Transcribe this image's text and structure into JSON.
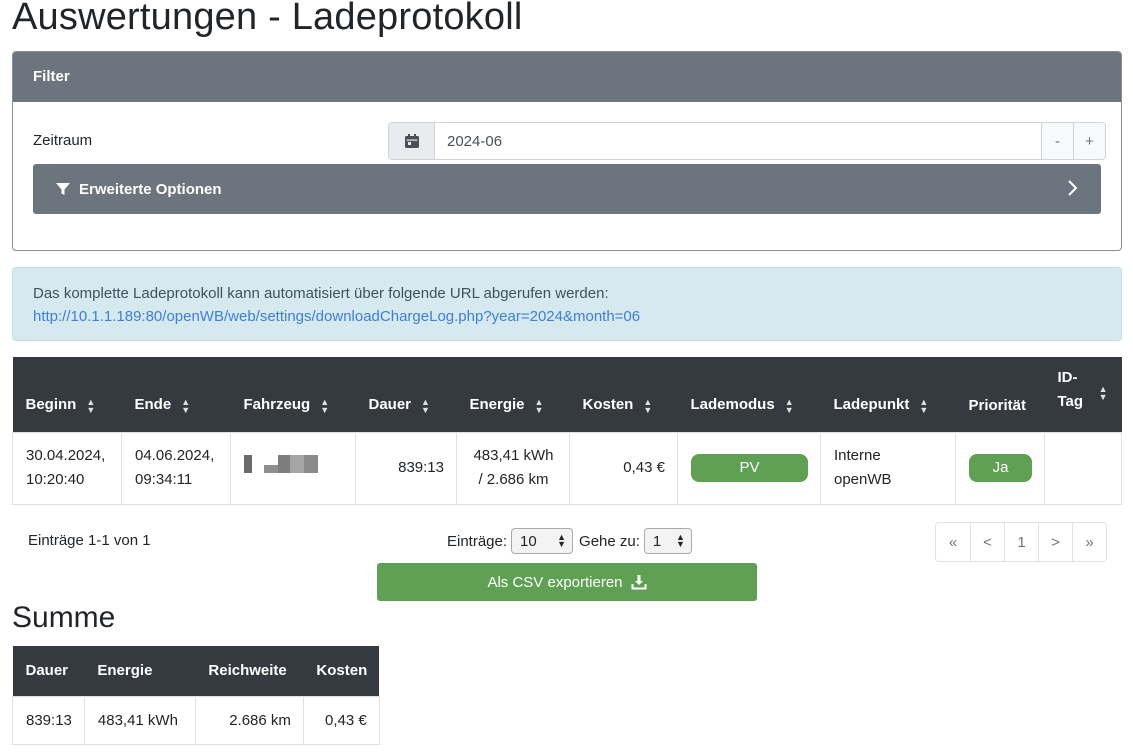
{
  "page": {
    "title": "Auswertungen - Ladeprotokoll"
  },
  "filter": {
    "header": "Filter",
    "zeitraum_label": "Zeitraum",
    "date_value": "2024-06",
    "minus_label": "-",
    "plus_label": "+",
    "advanced_label": "Erweiterte Optionen"
  },
  "info": {
    "text": "Das komplette Ladeprotokoll kann automatisiert über folgende URL abgerufen werden:",
    "url": "http://10.1.1.189:80/openWB/web/settings/downloadChargeLog.php?year=2024&month=06"
  },
  "table": {
    "headers": [
      "Beginn",
      "Ende",
      "Fahrzeug",
      "Dauer",
      "Energie",
      "Kosten",
      "Lademodus",
      "Ladepunkt",
      "Priorität",
      "ID-",
      "Tag"
    ],
    "row": {
      "beginn_1": "30.04.2024,",
      "beginn_2": "10:20:40",
      "ende_1": "04.06.2024,",
      "ende_2": "09:34:11",
      "dauer": "839:13",
      "energie_1": "483,41 kWh",
      "energie_2": "/ 2.686 km",
      "kosten": "0,43 €",
      "lademodus": "PV",
      "ladepunkt_1": "Interne",
      "ladepunkt_2": "openWB",
      "prioritaet": "Ja"
    }
  },
  "pagination": {
    "entries_text": "Einträge 1-1 von 1",
    "eintraege_label": "Einträge:",
    "eintraege_value": "10",
    "gehe_label": "Gehe zu:",
    "gehe_value": "1",
    "pages": [
      "«",
      "<",
      "1",
      ">",
      "»"
    ]
  },
  "csv_button": "Als CSV exportieren",
  "summe": {
    "title": "Summe",
    "headers": [
      "Dauer",
      "Energie",
      "Reichweite",
      "Kosten"
    ],
    "values": [
      "839:13",
      "483,41 kWh",
      "2.686 km",
      "0,43 €"
    ]
  },
  "colors": {
    "header_gray": "#6c757d",
    "table_dark": "#343a40",
    "success": "#5fa055",
    "info_bg": "#d6e9ee",
    "link": "#3f7fd6"
  }
}
